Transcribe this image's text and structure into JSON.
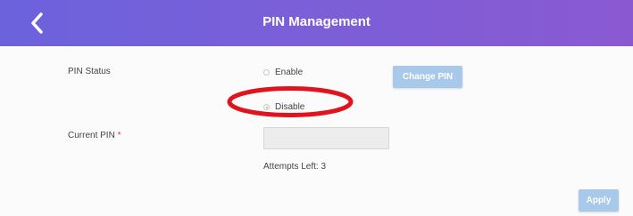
{
  "header": {
    "title": "PIN Management",
    "back_icon": "chevron-left-icon",
    "gradient": [
      "#6b63dc",
      "#8a59d2"
    ]
  },
  "form": {
    "pin_status_label": "PIN Status",
    "options": [
      {
        "label": "Enable",
        "checked": false
      },
      {
        "label": "Disable",
        "checked": true
      }
    ],
    "change_pin_label": "Change PIN",
    "current_pin_label": "Current PIN",
    "required_marker": "*",
    "current_pin_value": "",
    "attempts_left_text": "Attempts Left: 3",
    "apply_label": "Apply"
  },
  "annotation": {
    "color": "#e0141e",
    "shape": "ellipse"
  }
}
